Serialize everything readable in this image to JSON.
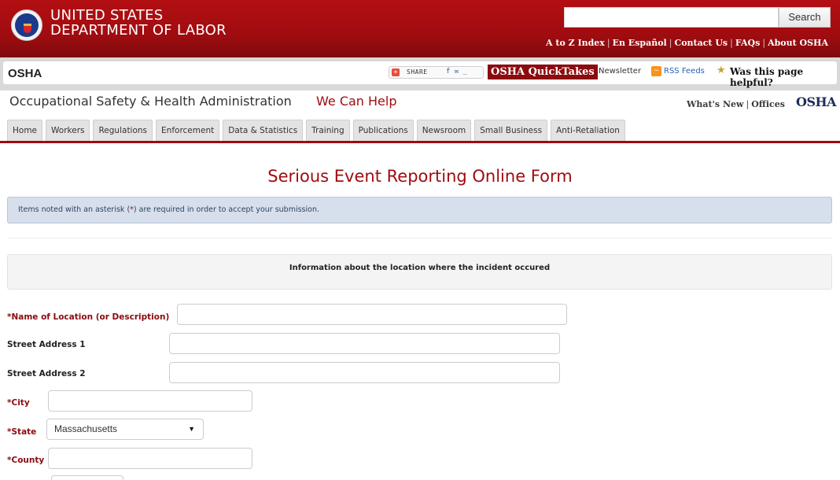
{
  "header": {
    "agency_line1": "UNITED STATES",
    "agency_line2": "DEPARTMENT OF LABOR",
    "seal_icon": "dol-seal-icon",
    "search": {
      "value": "",
      "placeholder": "",
      "button_label": "Search"
    },
    "top_links": [
      "A to Z Index",
      "En Español",
      "Contact Us",
      "FAQs",
      "About OSHA"
    ]
  },
  "osha_bar": {
    "title": "OSHA",
    "share_label": "SHARE",
    "share_icons": "f ✉ _",
    "quicktakes_label": "OSHA QuickTakes",
    "newsletter_label": "Newsletter",
    "rss_label": "RSS Feeds",
    "helpful_label": "Was this page helpful?"
  },
  "agency_row": {
    "full_name": "Occupational Safety & Health Administration",
    "we_can_help": "We Can Help",
    "whats_new": "What's New",
    "offices": "Offices",
    "logo_text": "OSHA"
  },
  "tabs": [
    {
      "label": "Home"
    },
    {
      "label": "Workers"
    },
    {
      "label": "Regulations"
    },
    {
      "label": "Enforcement"
    },
    {
      "label": "Data & Statistics"
    },
    {
      "label": "Training"
    },
    {
      "label": "Publications"
    },
    {
      "label": "Newsroom"
    },
    {
      "label": "Small Business"
    },
    {
      "label": "Anti-Retaliation"
    }
  ],
  "main": {
    "page_title": "Serious Event Reporting Online Form",
    "notice_before": "Items noted with an asterisk (",
    "notice_ast": "*",
    "notice_after": ") are required in order to accept your submission.",
    "section_heading": "Information about the location where the incident occured",
    "fields": {
      "location_name": {
        "label": "*Name of Location (or Description)",
        "value": ""
      },
      "street1": {
        "label": "Street Address 1",
        "value": ""
      },
      "street2": {
        "label": "Street Address 2",
        "value": ""
      },
      "city": {
        "label": "*City",
        "value": ""
      },
      "state": {
        "label": "*State",
        "value": "Massachusetts"
      },
      "county": {
        "label": "*County",
        "value": ""
      }
    }
  },
  "colors": {
    "brand_red": "#a00c10",
    "notice_bg": "#d6dfeb",
    "osha_navy": "#1c2d5b"
  }
}
